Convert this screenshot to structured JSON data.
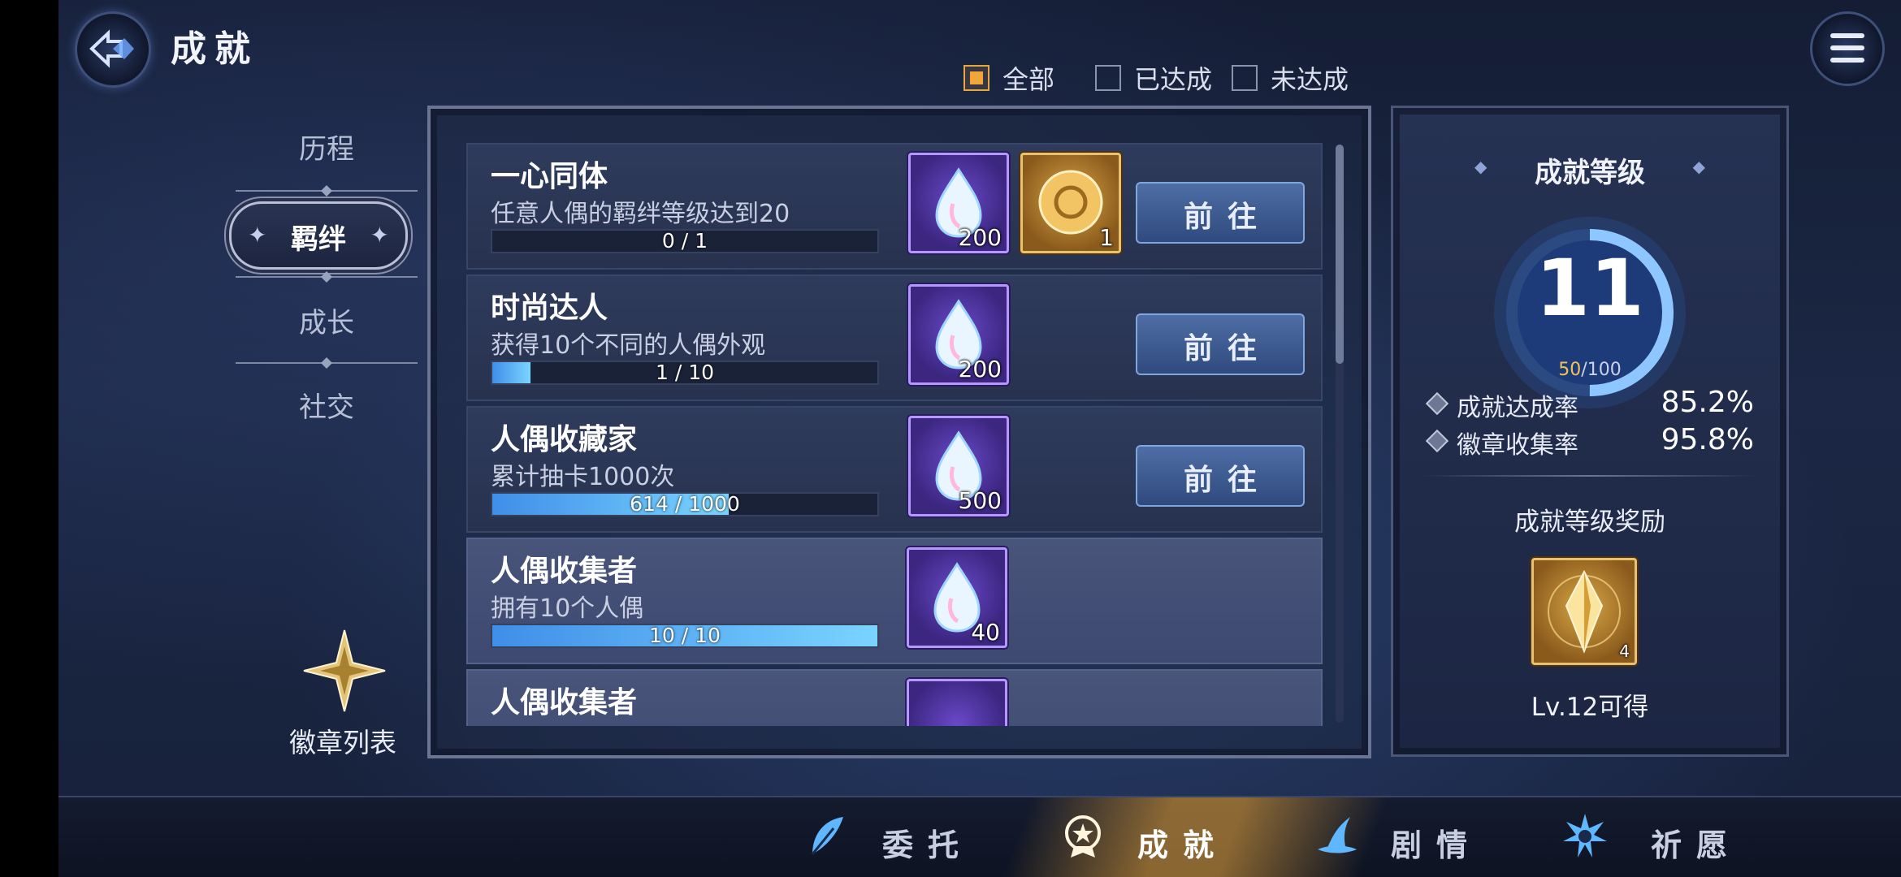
{
  "header": {
    "title": "成就"
  },
  "filters": [
    {
      "label": "全部",
      "checked": true
    },
    {
      "label": "已达成",
      "checked": false
    },
    {
      "label": "未达成",
      "checked": false
    }
  ],
  "categories": [
    {
      "label": "历程"
    },
    {
      "label": "羁绊",
      "active": true
    },
    {
      "label": "成长"
    },
    {
      "label": "社交"
    }
  ],
  "badge_list": {
    "label": "徽章列表"
  },
  "achievements": [
    {
      "title": "一心同体",
      "desc": "任意人偶的羁绊等级达到20",
      "progress_text": "0 / 1",
      "progress": 0.0,
      "rewards": [
        {
          "type": "gem",
          "qty": "200"
        },
        {
          "type": "coin",
          "qty": "1"
        }
      ],
      "button": "前往"
    },
    {
      "title": "时尚达人",
      "desc": "获得10个不同的人偶外观",
      "progress_text": "1 / 10",
      "progress": 0.1,
      "rewards": [
        {
          "type": "gem",
          "qty": "200"
        }
      ],
      "button": "前往"
    },
    {
      "title": "人偶收藏家",
      "desc": "累计抽卡1000次",
      "progress_text": "614 / 1000",
      "progress": 0.614,
      "rewards": [
        {
          "type": "gem",
          "qty": "500"
        }
      ],
      "button": "前往"
    },
    {
      "title": "人偶收集者",
      "desc": "拥有10个人偶",
      "progress_text": "10 / 10",
      "progress": 1.0,
      "rewards": [
        {
          "type": "gem",
          "qty": "40"
        }
      ]
    },
    {
      "title": "人偶收集者"
    }
  ],
  "stats": {
    "title": "成就等级",
    "level": "11",
    "exp_current": "50",
    "exp_total": "/100",
    "exp_progress": 0.5,
    "completion_label": "成就达成率",
    "completion_value": "85.2%",
    "badge_label": "徽章收集率",
    "badge_value": "95.8%",
    "reward_title": "成就等级奖励",
    "reward_qty": "4",
    "reward_condition": "Lv.12可得"
  },
  "bottom_nav": [
    {
      "label": "委托",
      "icon": "feather-icon"
    },
    {
      "label": "成就",
      "icon": "medal-icon",
      "active": true
    },
    {
      "label": "剧情",
      "icon": "witch-hat-icon"
    },
    {
      "label": "祈愿",
      "icon": "star-burst-icon"
    }
  ],
  "colors": {
    "accent": "#f0a63a",
    "progress": "#5ab0f5",
    "gem_border": "#b497ff",
    "gold": "#e8c270"
  }
}
